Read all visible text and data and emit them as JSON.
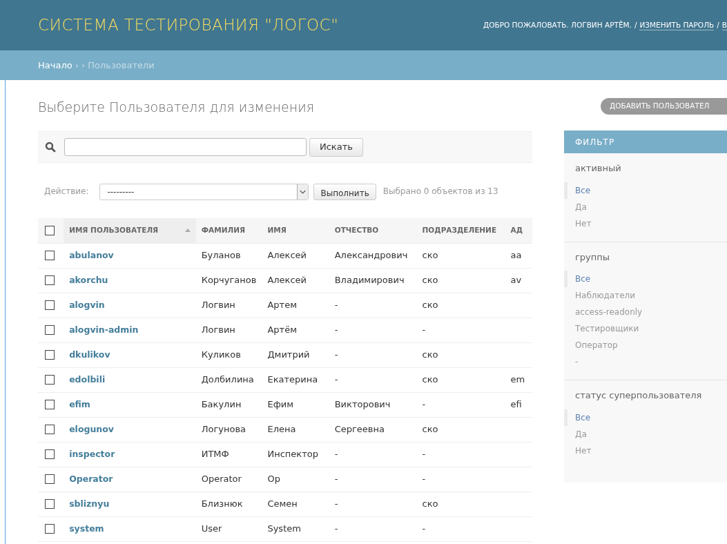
{
  "header": {
    "title": "СИСТЕМА ТЕСТИРОВАНИЯ \"ЛОГОС\"",
    "welcome": "ДОБРО ПОЖАЛОВАТЬ. ЛОГВИН АРТЁМ.",
    "links": [
      "ИЗМЕНИТЬ ПАРОЛЬ",
      "В"
    ],
    "separator": "/"
  },
  "breadcrumbs": {
    "items": [
      "Начало",
      "Пользователи"
    ],
    "separator": "› ›"
  },
  "page_title": "Выберите Пользователя для изменения",
  "add_button": "ДОБАВИТЬ ПОЛЬЗОВАТЕЛ",
  "search": {
    "button": "Искать"
  },
  "actions": {
    "label": "Действие:",
    "select_value": "---------",
    "button": "Выполнить",
    "counter": "Выбрано 0 объектов из 13"
  },
  "table": {
    "columns": [
      {
        "label": "ИМЯ ПОЛЬЗОВАТЕЛЯ",
        "sorted": true
      },
      {
        "label": "ФАМИЛИЯ",
        "sorted": false
      },
      {
        "label": "ИМЯ",
        "sorted": false
      },
      {
        "label": "ОТЧЕСТВО",
        "sorted": false
      },
      {
        "label": "ПОДРАЗДЕЛЕНИЕ",
        "sorted": false
      },
      {
        "label": "АД",
        "sorted": false
      }
    ],
    "header_checked": false,
    "rows": [
      {
        "checked": false,
        "cells": [
          "abulanov",
          "Буланов",
          "Алексей",
          "Александрович",
          "cко",
          "aa"
        ]
      },
      {
        "checked": false,
        "cells": [
          "akorchu",
          "Корчуганов",
          "Алексей",
          "Владимирович",
          "cко",
          "av"
        ]
      },
      {
        "checked": false,
        "cells": [
          "alogvin",
          "Логвин",
          "Артем",
          "-",
          "cко",
          ""
        ]
      },
      {
        "checked": false,
        "cells": [
          "alogvin-admin",
          "Логвин",
          "Артём",
          "-",
          "-",
          ""
        ]
      },
      {
        "checked": false,
        "cells": [
          "dkulikov",
          "Куликов",
          "Дмитрий",
          "-",
          "cко",
          ""
        ]
      },
      {
        "checked": false,
        "cells": [
          "edolbili",
          "Долбилина",
          "Екатерина",
          "-",
          "cко",
          "em"
        ]
      },
      {
        "checked": false,
        "cells": [
          "efim",
          "Бакулин",
          "Ефим",
          "Викторович",
          "-",
          "efi"
        ]
      },
      {
        "checked": false,
        "cells": [
          "elogunov",
          "Логунова",
          "Елена",
          "Сергеевна",
          "cко",
          ""
        ]
      },
      {
        "checked": false,
        "cells": [
          "inspector",
          "ИТМФ",
          "Инспектор",
          "-",
          "-",
          ""
        ]
      },
      {
        "checked": false,
        "cells": [
          "Operator",
          "Operator",
          "Op",
          "-",
          "-",
          ""
        ]
      },
      {
        "checked": false,
        "cells": [
          "sbliznyu",
          "Близнюк",
          "Семен",
          "-",
          "cко",
          ""
        ]
      },
      {
        "checked": false,
        "cells": [
          "system",
          "User",
          "System",
          "-",
          "-",
          ""
        ]
      }
    ]
  },
  "filter": {
    "title": "ФИЛЬТР",
    "sections": [
      {
        "title": "активный",
        "items": [
          {
            "label": "Все",
            "selected": true
          },
          {
            "label": "Да",
            "selected": false
          },
          {
            "label": "Нет",
            "selected": false
          }
        ]
      },
      {
        "title": "группы",
        "items": [
          {
            "label": "Все",
            "selected": true
          },
          {
            "label": "Наблюдатели",
            "selected": false
          },
          {
            "label": "access-readonly",
            "selected": false
          },
          {
            "label": "Тестировщики",
            "selected": false
          },
          {
            "label": "Оператор",
            "selected": false
          },
          {
            "label": "-",
            "selected": false
          }
        ]
      },
      {
        "title": "статус суперпользователя",
        "items": [
          {
            "label": "Все",
            "selected": true
          },
          {
            "label": "Да",
            "selected": false
          },
          {
            "label": "Нет",
            "selected": false
          }
        ]
      }
    ]
  }
}
